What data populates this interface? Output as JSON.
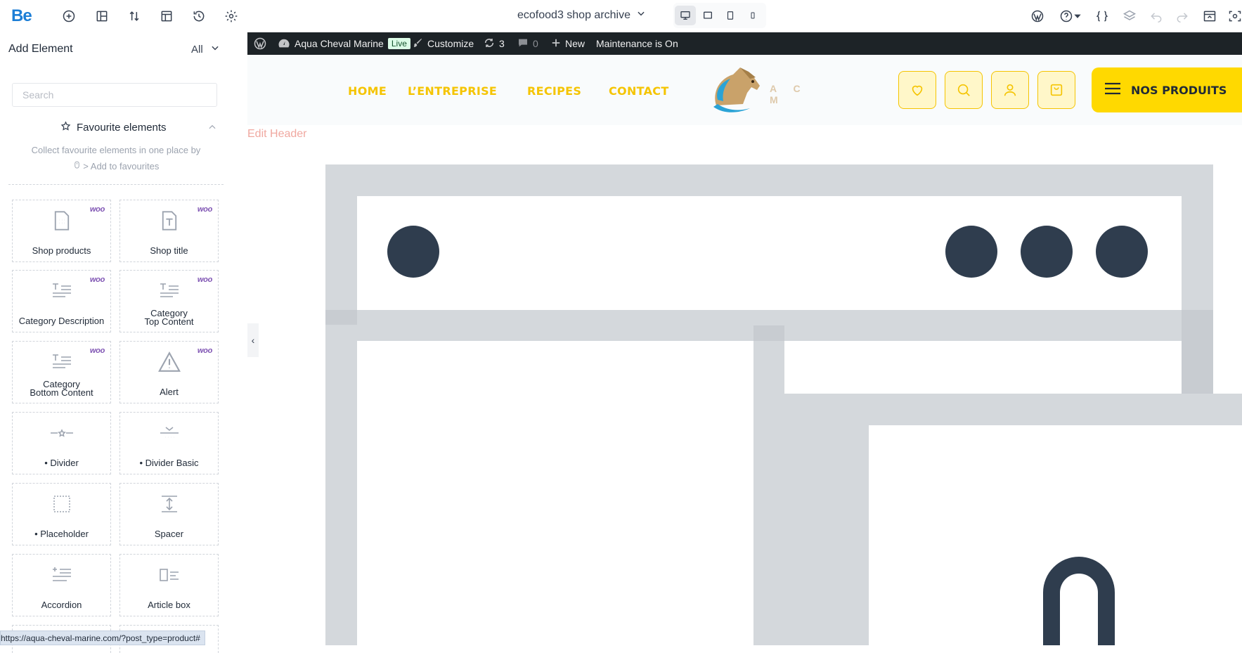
{
  "toolbar": {
    "logo": "Be",
    "document_title": "ecofood3 shop archive",
    "icons": [
      "add-element-icon",
      "layout-icon",
      "sort-icon",
      "template-icon",
      "history-icon",
      "settings-icon"
    ],
    "right_icons": [
      "wordpress-icon",
      "help-icon",
      "css-icon",
      "layers-icon",
      "undo-icon",
      "redo-icon",
      "preview-icon",
      "view-icon"
    ]
  },
  "left_panel": {
    "title": "Add Element",
    "filter_label": "All",
    "search_placeholder": "Search",
    "favourites": {
      "heading": "Favourite elements",
      "description_line1": "Collect favourite elements in one place by",
      "description_line2": "> Add to favourites"
    },
    "elements": [
      {
        "label": "Shop products",
        "badge": "woo",
        "icon": "shop-products-icon"
      },
      {
        "label": "Shop title",
        "badge": "woo",
        "icon": "shop-title-icon"
      },
      {
        "label": "Category Description",
        "badge": "woo",
        "icon": "text-lines-icon"
      },
      {
        "label_line1": "Category",
        "label_line2": "Top Content",
        "badge": "woo",
        "icon": "text-lines-icon"
      },
      {
        "label_line1": "Category",
        "label_line2": "Bottom Content",
        "badge": "woo",
        "icon": "text-lines-icon"
      },
      {
        "label": "Alert",
        "badge": "woo",
        "icon": "alert-triangle-icon"
      },
      {
        "label": "• Divider",
        "badge": "",
        "icon": "divider-icon"
      },
      {
        "label": "• Divider Basic",
        "badge": "",
        "icon": "divider-basic-icon"
      },
      {
        "label": "• Placeholder",
        "badge": "",
        "icon": "placeholder-icon"
      },
      {
        "label": "Spacer",
        "badge": "",
        "icon": "spacer-icon"
      },
      {
        "label": "Accordion",
        "badge": "",
        "icon": "accordion-icon"
      },
      {
        "label": "Article box",
        "badge": "",
        "icon": "article-box-icon"
      }
    ],
    "status_url": "https://aqua-cheval-marine.com/?post_type=product#"
  },
  "wp_admin_bar": {
    "site_name": "Aqua Cheval Marine",
    "live_badge": "Live",
    "customize": "Customize",
    "updates_count": "3",
    "comments_count": "0",
    "new_label": "New",
    "maintenance": "Maintenance is On"
  },
  "site_header": {
    "nav": [
      "HOME",
      "L’ENTREPRISE",
      "RECIPES",
      "CONTACT"
    ],
    "logo_text": "A  C  M",
    "buttons": [
      "heart-icon",
      "search-icon",
      "user-icon",
      "cart-icon"
    ],
    "cta": "NOS PRODUITS",
    "accent_color": "#f5c400",
    "edit_header": "Edit Header"
  },
  "canvas": {
    "placeholder_color": "#d4d8dc",
    "dot_color": "#2f3d4e"
  }
}
